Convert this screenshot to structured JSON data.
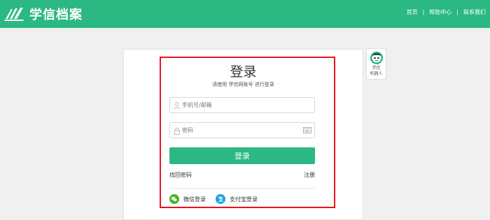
{
  "header": {
    "brand": "学信档案",
    "nav": [
      "首页",
      "帮助中心",
      "联系我们"
    ],
    "separator": "|",
    "color": "#2bb883"
  },
  "login": {
    "title": "登录",
    "subtitle": "请使用 学信网账号 进行登录",
    "username_placeholder": "手机号/邮箱",
    "password_placeholder": "密码",
    "submit_label": "登录",
    "forgot_label": "找回密码",
    "register_label": "注册",
    "wechat_label": "微信登录",
    "alipay_label": "支付宝登录",
    "highlight_color": "#e8141b"
  },
  "robot": {
    "label_line1": "学信",
    "label_line2": "机器人"
  },
  "icons": [
    "logo-mark-icon",
    "user-icon",
    "lock-icon",
    "keyboard-icon",
    "wechat-icon",
    "alipay-icon",
    "robot-icon"
  ]
}
